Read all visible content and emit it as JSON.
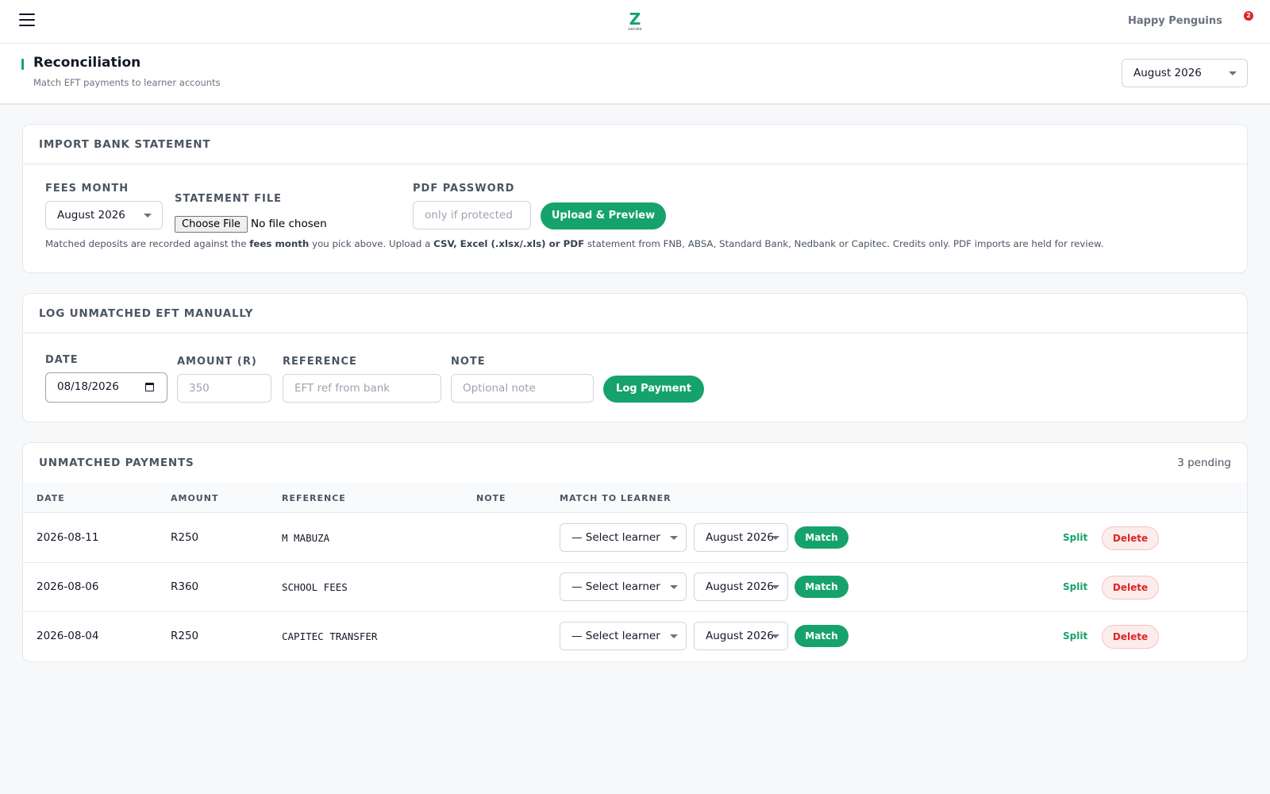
{
  "header": {
    "logo_letter": "Z",
    "logo_word": "zande",
    "school_name": "Happy Penguins",
    "notification_count": "2"
  },
  "page": {
    "title": "Reconciliation",
    "subtitle": "Match EFT payments to learner accounts",
    "month_selector": "August 2026"
  },
  "import_card": {
    "title": "IMPORT BANK STATEMENT",
    "fees_month_label": "FEES MONTH",
    "fees_month_value": "August 2026",
    "statement_file_label": "STATEMENT FILE",
    "choose_file_label": "Choose File",
    "file_status": "No file chosen",
    "pdf_password_label": "PDF PASSWORD",
    "pdf_password_placeholder": "only if protected",
    "upload_button": "Upload & Preview",
    "help_part1": "Matched deposits are recorded against the ",
    "help_bold1": "fees month",
    "help_part2": " you pick above. Upload a ",
    "help_bold2": "CSV, Excel (.xlsx/.xls) or PDF",
    "help_part3": " statement from FNB, ABSA, Standard Bank, Nedbank or Capitec. Credits only. PDF imports are held for review."
  },
  "log_card": {
    "title": "LOG UNMATCHED EFT MANUALLY",
    "date_label": "DATE",
    "date_value": "08/18/2026",
    "amount_label": "AMOUNT (R)",
    "amount_placeholder": "350",
    "reference_label": "REFERENCE",
    "reference_placeholder": "EFT ref from bank",
    "note_label": "NOTE",
    "note_placeholder": "Optional note",
    "log_button": "Log Payment"
  },
  "unmatched": {
    "title": "UNMATCHED PAYMENTS",
    "pending": "3 pending",
    "columns": [
      "DATE",
      "AMOUNT",
      "REFERENCE",
      "NOTE",
      "MATCH TO LEARNER"
    ],
    "rows": [
      {
        "date": "2026-08-11",
        "amount": "R250",
        "reference": "M MABUZA",
        "note": "",
        "learner": "— Select learner",
        "month": "August 2026",
        "match": "Match",
        "split": "Split",
        "delete": "Delete"
      },
      {
        "date": "2026-08-06",
        "amount": "R360",
        "reference": "SCHOOL FEES",
        "note": "",
        "learner": "— Select learner",
        "month": "August 2026",
        "match": "Match",
        "split": "Split",
        "delete": "Delete"
      },
      {
        "date": "2026-08-04",
        "amount": "R250",
        "reference": "CAPITEC TRANSFER",
        "note": "",
        "learner": "— Select learner",
        "month": "August 2026",
        "match": "Match",
        "split": "Split",
        "delete": "Delete"
      }
    ]
  }
}
